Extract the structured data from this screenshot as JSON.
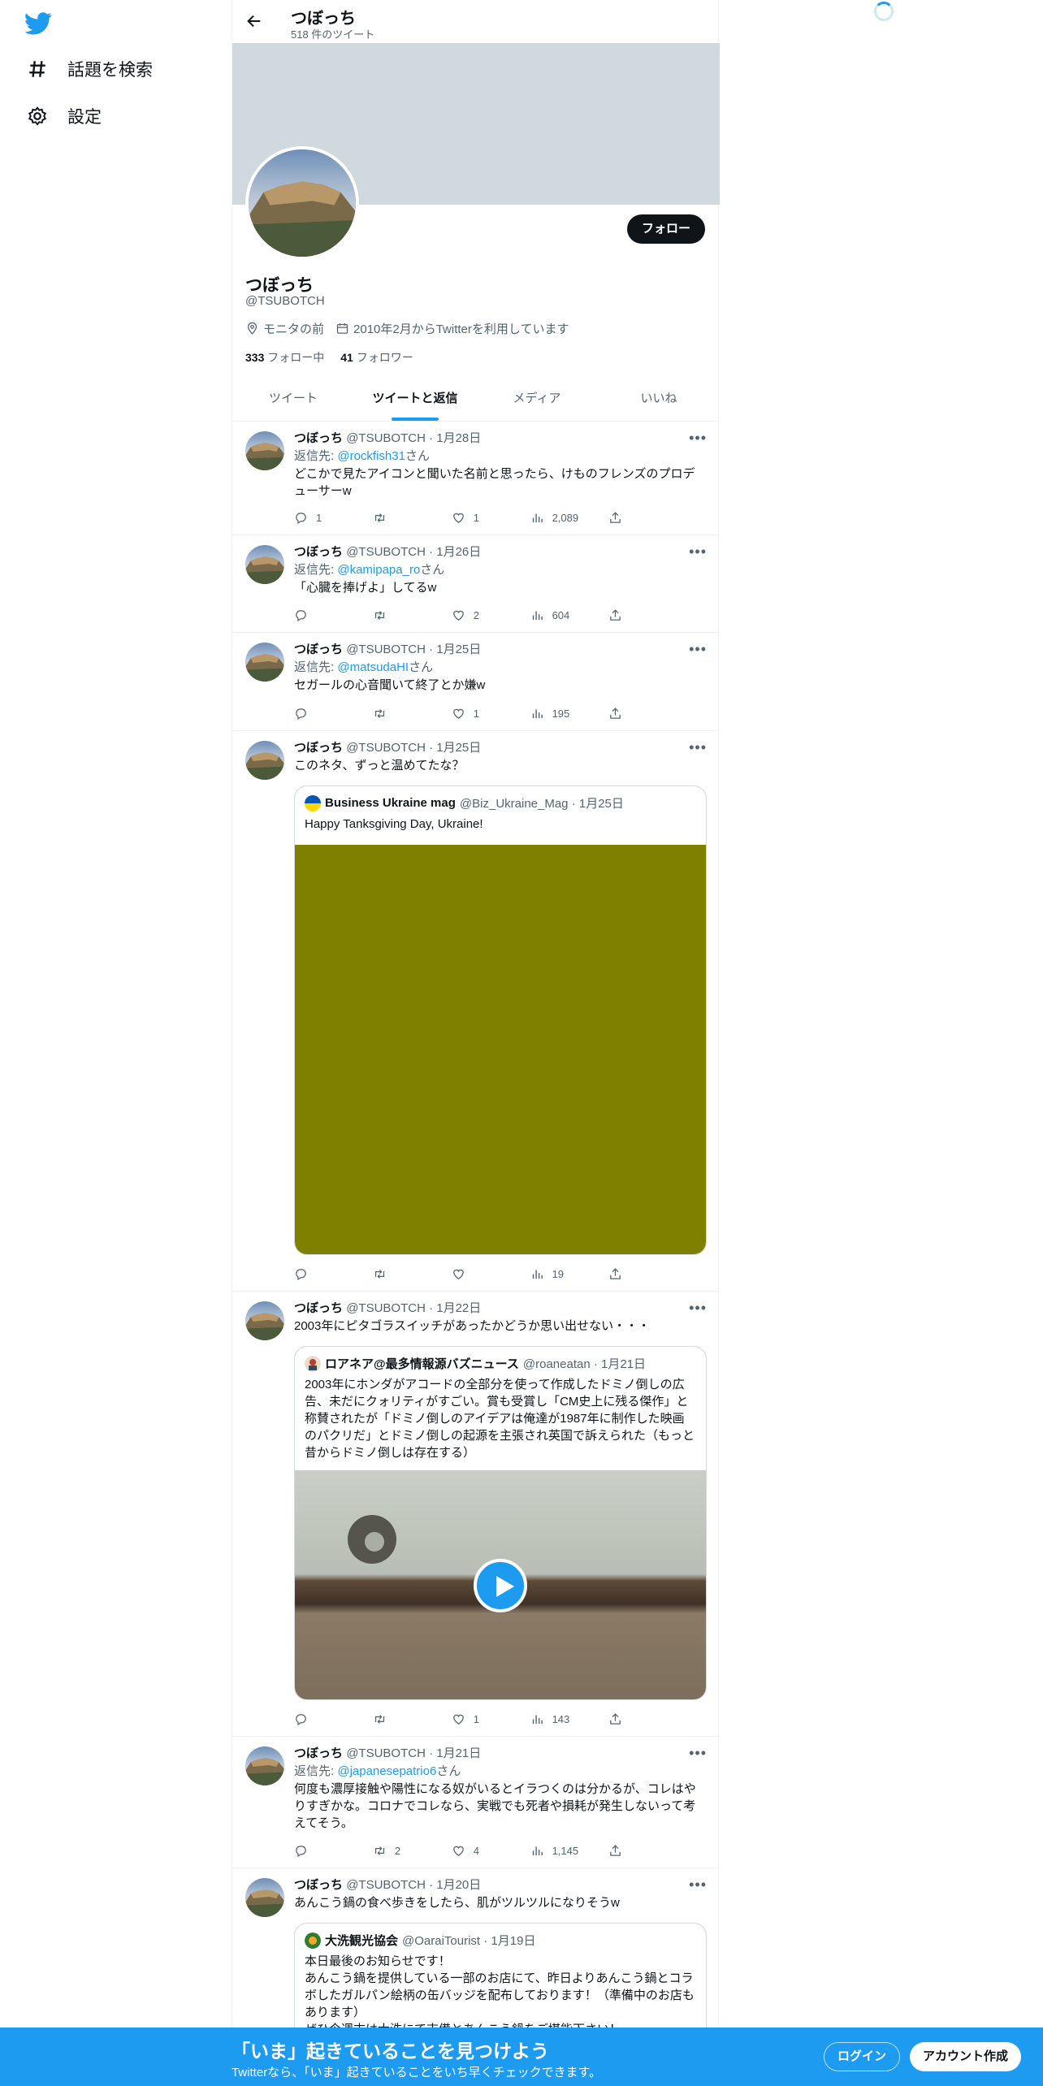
{
  "nav": {
    "explore": "話題を検索",
    "settings": "設定"
  },
  "topbar": {
    "name": "つぼっち",
    "tweet_count": "518 件のツイート"
  },
  "profile": {
    "name": "つぼっち",
    "handle": "@TSUBOTCH",
    "location": "モニタの前",
    "joined": "2010年2月からTwitterを利用しています",
    "following_count": "333",
    "following_label": "フォロー中",
    "followers_count": "41",
    "followers_label": "フォロワー",
    "follow_button": "フォロー"
  },
  "tabs": [
    "ツイート",
    "ツイートと返信",
    "メディア",
    "いいね"
  ],
  "active_tab": "ツイートと返信",
  "colors": {
    "accent": "#1d9bf0",
    "banner": "#cfd9de",
    "media_olive": "#808000"
  },
  "tweets": [
    {
      "name": "つぼっち",
      "meta": "@TSUBOTCH · 1月28日",
      "reply_prefix": "返信先: ",
      "reply_to": "@rockfish31",
      "reply_suffix": "さん",
      "text": "どこかで見たアイコンと聞いた名前と思ったら、けものフレンズのプロデューサーw",
      "replies": "1",
      "retweets": "",
      "likes": "1",
      "views": "2,089"
    },
    {
      "name": "つぼっち",
      "meta": "@TSUBOTCH · 1月26日",
      "reply_prefix": "返信先: ",
      "reply_to": "@kamipapa_ro",
      "reply_suffix": "さん",
      "text": "「心臓を捧げよ」してるw",
      "replies": "",
      "retweets": "",
      "likes": "2",
      "views": "604"
    },
    {
      "name": "つぼっち",
      "meta": "@TSUBOTCH · 1月25日",
      "reply_prefix": "返信先: ",
      "reply_to": "@matsudaHI",
      "reply_suffix": "さん",
      "text": "セガールの心音聞いて終了とか嫌w",
      "replies": "",
      "retweets": "",
      "likes": "1",
      "views": "195"
    },
    {
      "name": "つぼっち",
      "meta": "@TSUBOTCH · 1月25日",
      "text": "このネタ、ずっと温めてたな？",
      "quote": {
        "name": "Business Ukraine mag",
        "meta": "@Biz_Ukraine_Mag · 1月25日",
        "text": "Happy Tanksgiving Day, Ukraine!"
      },
      "replies": "",
      "retweets": "",
      "likes": "",
      "views": "19"
    },
    {
      "name": "つぼっち",
      "meta": "@TSUBOTCH · 1月22日",
      "text": "2003年にピタゴラスイッチがあったかどうか思い出せない・・・",
      "quote": {
        "name": "ロアネア@最多情報源バズニュース",
        "meta": "@roaneatan · 1月21日",
        "text": "2003年にホンダがアコードの全部分を使って作成したドミノ倒しの広告、未だにクォリティがすごい。賞も受賞し「CM史上に残る傑作」と称賛されたが「ドミノ倒しのアイデアは俺達が1987年に制作した映画のパクリだ」とドミノ倒しの起源を主張され英国で訴えられた（もっと昔からドミノ倒しは存在する）"
      },
      "replies": "",
      "retweets": "",
      "likes": "1",
      "views": "143"
    },
    {
      "name": "つぼっち",
      "meta": "@TSUBOTCH · 1月21日",
      "reply_prefix": "返信先: ",
      "reply_to": "@japanesepatrio6",
      "reply_suffix": "さん",
      "text": "何度も濃厚接触や陽性になる奴がいるとイラつくのは分かるが、コレはやりすぎかな。コロナでコレなら、実戦でも死者や損耗が発生しないって考えてそう。",
      "replies": "",
      "retweets": "2",
      "likes": "4",
      "views": "1,145"
    },
    {
      "name": "つぼっち",
      "meta": "@TSUBOTCH · 1月20日",
      "text": "あんこう鍋の食べ歩きをしたら、肌がツルツルになりそうw",
      "quote": {
        "name": "大洗観光協会",
        "meta": "@OaraiTourist · 1月19日",
        "text": "本日最後のお知らせです！\nあんこう鍋を提供している一部のお店にて、昨日よりあんこう鍋とコラボしたガルパン絵柄の缶バッジを配布しております！（準備中のお店もあります）\nぜひ今週末は大洗にて吉備とあんこう鍋をご堪能下さい！"
      }
    }
  ],
  "bottom_bar": {
    "title": "「いま」起きていることを見つけよう",
    "subtitle": "Twitterなら、「いま」起きていることをいち早くチェックできます。",
    "login": "ログイン",
    "signup": "アカウント作成"
  }
}
